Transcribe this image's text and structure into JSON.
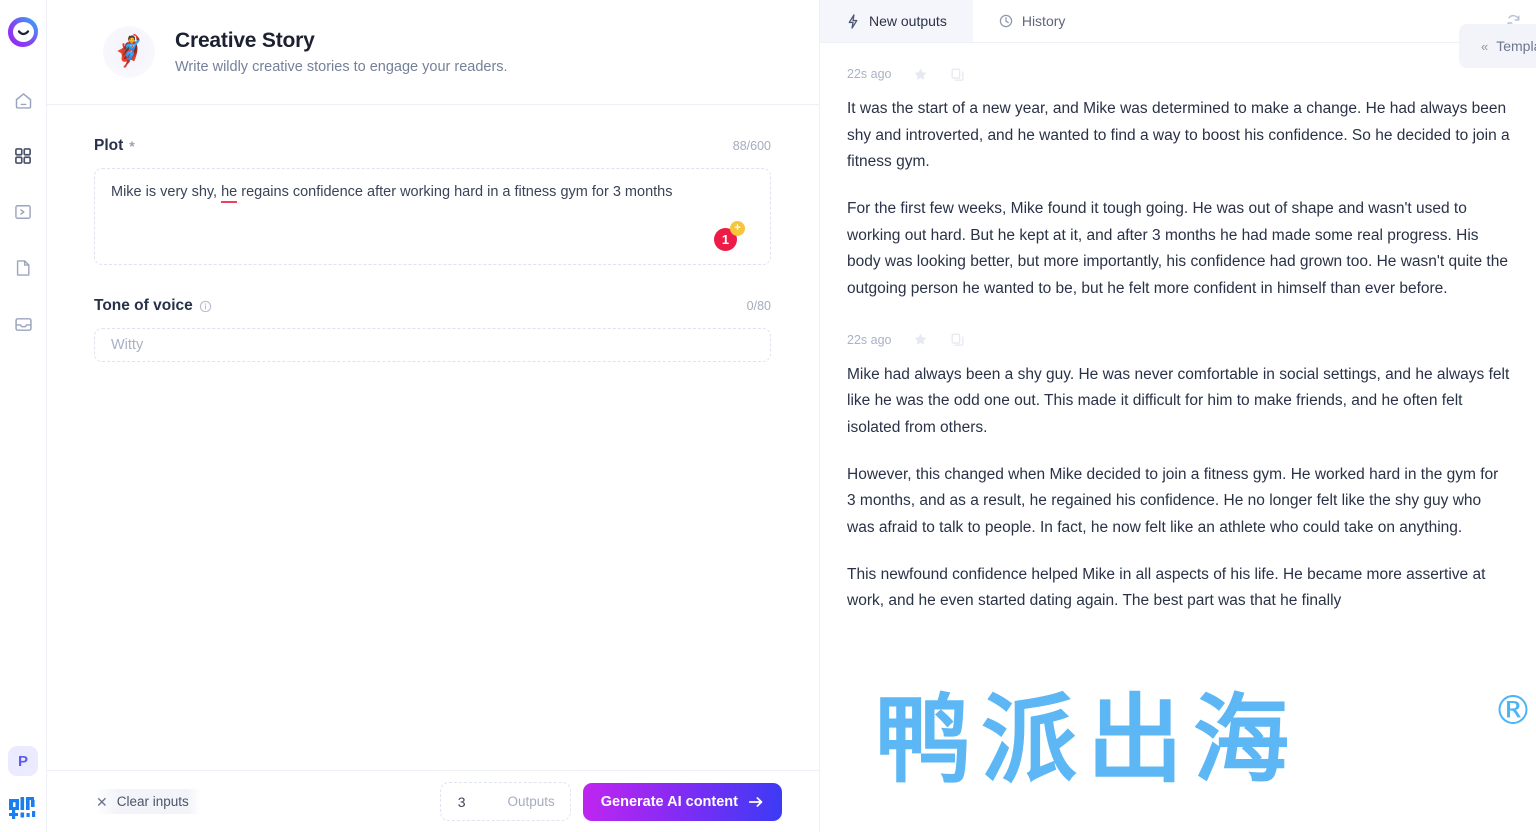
{
  "app": {
    "logo_icon": "smiley-blob-logo",
    "watermark_text": "鸭派出海",
    "watermark_mark": "®"
  },
  "sidebar": {
    "items": [
      {
        "icon": "home-icon",
        "name": "home"
      },
      {
        "icon": "grid-apps-icon",
        "name": "apps"
      },
      {
        "icon": "terminal-icon",
        "name": "terminal"
      },
      {
        "icon": "document-icon",
        "name": "documents"
      },
      {
        "icon": "inbox-icon",
        "name": "inbox"
      }
    ],
    "avatar_initial": "P",
    "brand_icon": "blue-cjk-logo"
  },
  "header": {
    "emoji": "🦸",
    "title": "Creative Story",
    "subtitle": "Write wildly creative stories to engage your readers.",
    "templates_label": "Templates",
    "templates_icon": "chevron-double-left-icon"
  },
  "form": {
    "plot": {
      "label": "Plot",
      "required_mark": "*",
      "counter": "88/600",
      "value_before": "Mike is very shy, ",
      "value_spellcheck": "he",
      "value_after": " regains confidence after working hard in a fitness gym for 3 months",
      "badge_count": "1",
      "badge_plus": "+"
    },
    "tone": {
      "label": "Tone of voice",
      "info_icon": "info-circle-icon",
      "counter": "0/80",
      "placeholder": "Witty",
      "value": ""
    }
  },
  "actions": {
    "clear_label": "Clear inputs",
    "clear_icon": "close-x-icon",
    "outputs_count": "3",
    "outputs_label": "Outputs",
    "generate_label": "Generate AI content",
    "generate_icon": "arrow-right-icon"
  },
  "results": {
    "tabs": [
      {
        "label": "New outputs",
        "icon": "lightning-icon",
        "active": true
      },
      {
        "label": "History",
        "icon": "clock-icon",
        "active": false
      }
    ],
    "refresh_icon": "refresh-icon",
    "items": [
      {
        "time": "22s ago",
        "star_icon": "star-icon",
        "copy_icon": "copy-icon",
        "paragraphs": [
          "It was the start of a new year, and Mike was determined to make a change. He had always been shy and introverted, and he wanted to find a way to boost his confidence. So he decided to join a fitness gym.",
          "For the first few weeks, Mike found it tough going. He was out of shape and wasn't used to working out hard. But he kept at it, and after 3 months he had made some real progress. His body was looking better, but more importantly, his confidence had grown too. He wasn't quite the outgoing person he wanted to be, but he felt more confident in himself than ever before."
        ]
      },
      {
        "time": "22s ago",
        "star_icon": "star-icon",
        "copy_icon": "copy-icon",
        "paragraphs": [
          "Mike had always been a shy guy. He was never comfortable in social settings, and he always felt like he was the odd one out. This made it difficult for him to make friends, and he often felt isolated from others.",
          "However, this changed when Mike decided to join a fitness gym. He worked hard in the gym for 3 months, and as a result, he regained his confidence. He no longer felt like the shy guy who was afraid to talk to people. In fact, he now felt like an athlete who could take on anything.",
          "This newfound confidence helped Mike in all aspects of his life. He became more assertive at work, and he even started dating again. The best part was that he finally"
        ]
      }
    ]
  },
  "colors": {
    "accent_purple": "#8b2af3",
    "accent_blue": "#3b3bf5",
    "badge_red": "#ed1b45",
    "badge_yellow": "#f7c53c",
    "watermark_blue": "#1e9cf0"
  }
}
